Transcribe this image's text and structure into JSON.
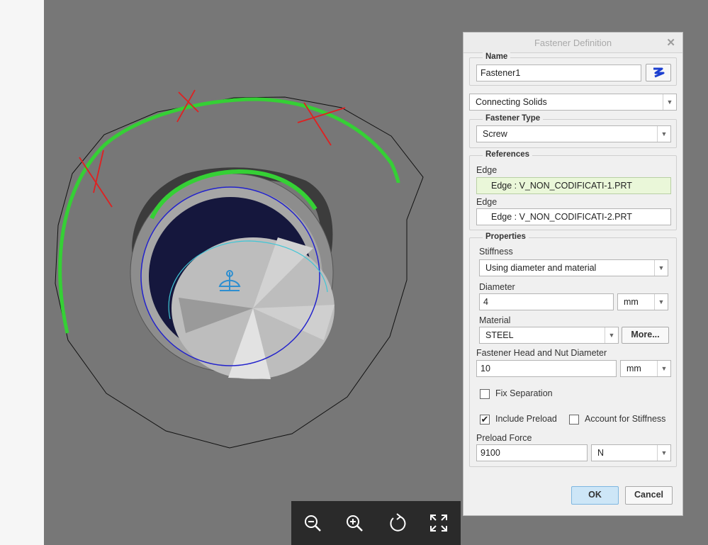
{
  "dialog": {
    "title": "Fastener Definition",
    "close": "✕",
    "name_legend": "Name",
    "name_value": "Fastener1",
    "connection_type": "Connecting Solids",
    "fastener_type_legend": "Fastener Type",
    "fastener_type": "Screw",
    "references_legend": "References",
    "edge1_label": "Edge",
    "edge1_value": "Edge : V_NON_CODIFICATI-1.PRT",
    "edge2_label": "Edge",
    "edge2_value": "Edge : V_NON_CODIFICATI-2.PRT",
    "properties_legend": "Properties",
    "stiffness_label": "Stiffness",
    "stiffness_value": "Using diameter and material",
    "diameter_label": "Diameter",
    "diameter_value": "4",
    "diameter_unit": "mm",
    "material_label": "Material",
    "material_value": "STEEL",
    "more_button": "More...",
    "head_nut_label": "Fastener Head and Nut Diameter",
    "head_nut_value": "10",
    "head_nut_unit": "mm",
    "fix_separation_label": "Fix Separation",
    "fix_separation_checked": false,
    "include_preload_label": "Include Preload",
    "include_preload_checked": true,
    "account_stiffness_label": "Account for Stiffness",
    "account_stiffness_checked": false,
    "preload_force_label": "Preload Force",
    "preload_force_value": "9100",
    "preload_force_unit": "N",
    "ok_button": "OK",
    "cancel_button": "Cancel"
  },
  "toolbar": {
    "icons": [
      "zoom-out-icon",
      "zoom-in-icon",
      "rotate-icon",
      "fit-screen-icon"
    ]
  },
  "colors": {
    "viewport_bg": "#777777",
    "highlight_green": "#35d035",
    "x_mark_red": "#e02020",
    "edge_blue": "#2222cc",
    "edge_cyan": "#3fc6d6"
  }
}
